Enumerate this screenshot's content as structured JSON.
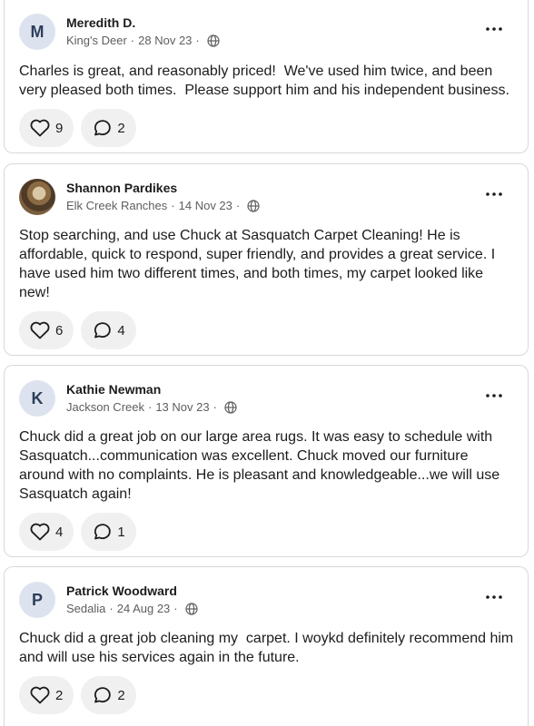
{
  "posts": [
    {
      "avatar_letter": "M",
      "author": "Meredith D.",
      "neighborhood": "King's Deer",
      "date": "28 Nov 23",
      "text": "Charles is great, and reasonably priced!  We've used him twice, and been very pleased both times.  Please support him and his independent business.",
      "likes": "9",
      "comments": "2"
    },
    {
      "avatar_letter": "",
      "author": "Shannon Pardikes",
      "neighborhood": "Elk Creek Ranches",
      "date": "14 Nov 23",
      "text": "Stop searching, and use Chuck at Sasquatch Carpet Cleaning! He is affordable, quick to respond, super friendly, and provides a great service. I have used him two different times, and both times, my carpet looked like new!",
      "likes": "6",
      "comments": "4"
    },
    {
      "avatar_letter": "K",
      "author": "Kathie Newman",
      "neighborhood": "Jackson Creek",
      "date": "13 Nov 23",
      "text": "Chuck did a great job on our large area rugs. It was easy to schedule with Sasquatch...communication was excellent. Chuck moved our furniture around with no complaints. He is pleasant and knowledgeable...we will use Sasquatch again!",
      "likes": "4",
      "comments": "1"
    },
    {
      "avatar_letter": "P",
      "author": "Patrick Woodward",
      "neighborhood": "Sedalia",
      "date": "24 Aug 23",
      "text": "Chuck did a great job cleaning my  carpet. I woykd definitely recommend him and will use his services again in the future.",
      "likes": "2",
      "comments": "2"
    }
  ],
  "icons": {
    "more": "more-horizontal-icon",
    "globe": "globe-icon",
    "like": "heart-icon",
    "comment": "comment-bubble-icon"
  }
}
